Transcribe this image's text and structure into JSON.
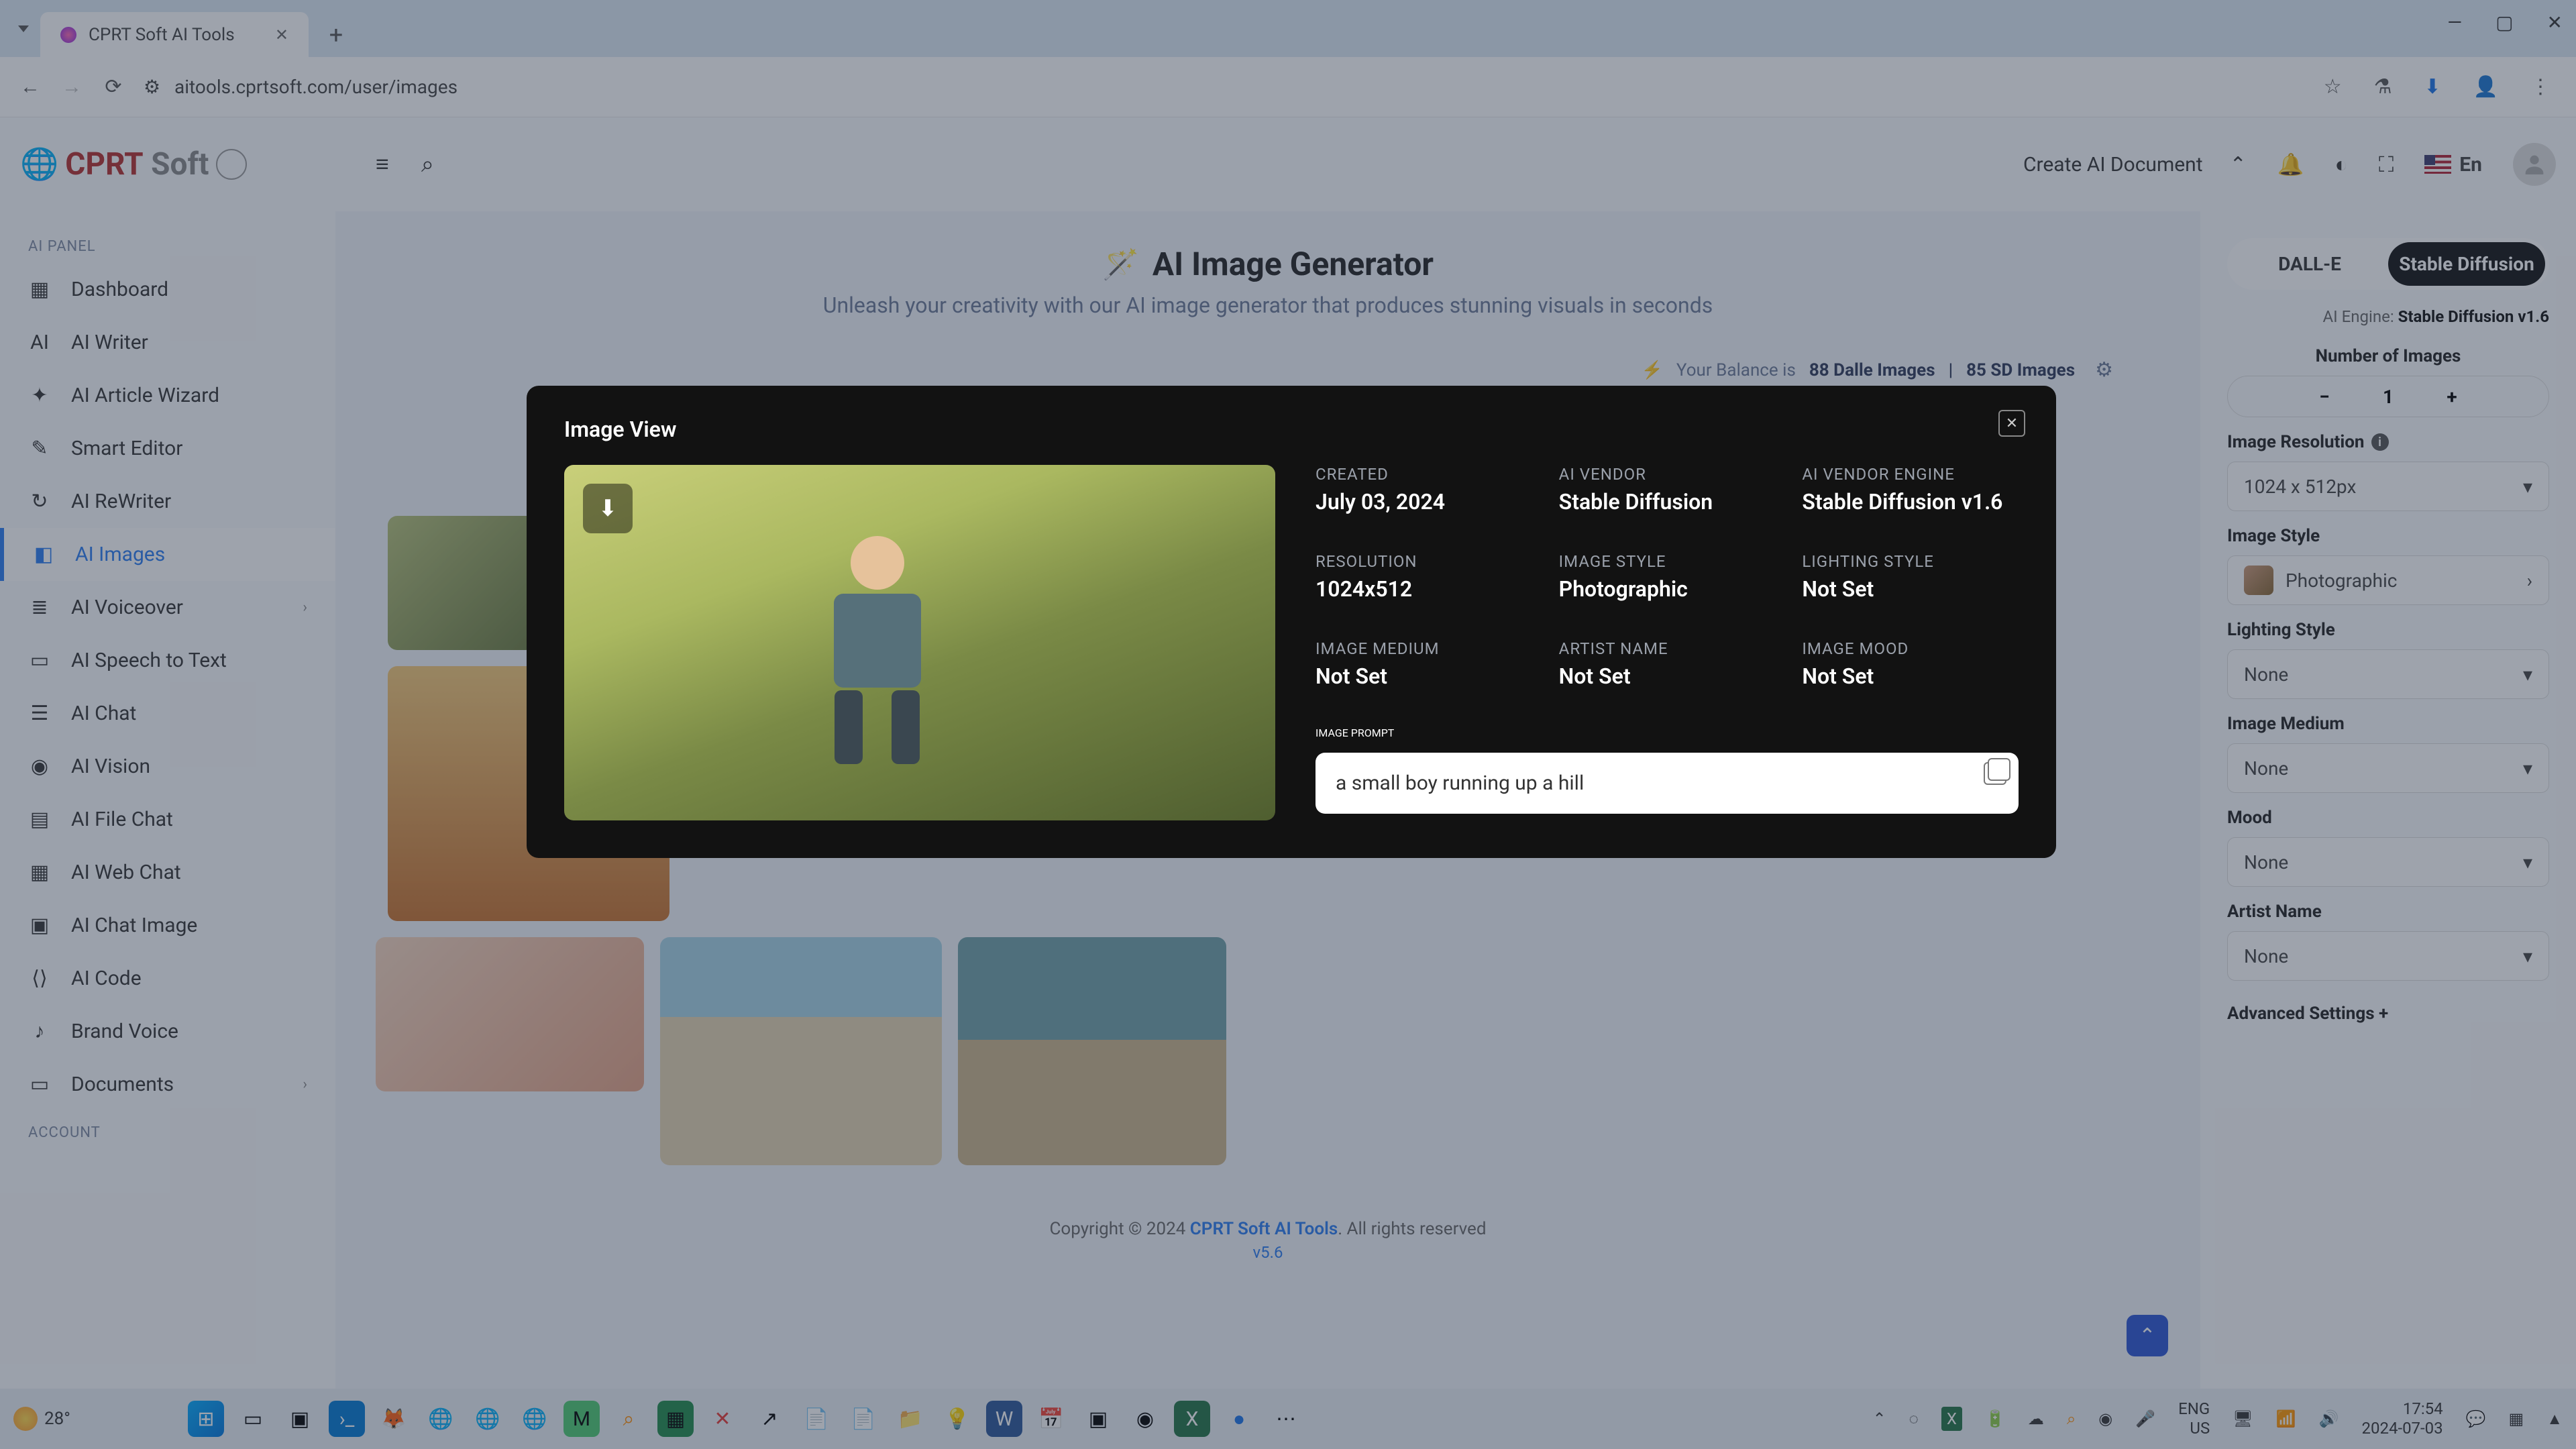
{
  "browser": {
    "tab_title": "CPRT Soft AI Tools",
    "url": "aitools.cprtsoft.com/user/images"
  },
  "window_controls": {
    "min": "—",
    "max": "▢",
    "close": "✕"
  },
  "header": {
    "logo_main": "CPRT",
    "logo_sub": "Soft",
    "create_doc": "Create AI Document",
    "lang": "En"
  },
  "sidebar": {
    "section1": "AI PANEL",
    "items": [
      {
        "label": "Dashboard",
        "icon": "▦"
      },
      {
        "label": "AI Writer",
        "icon": "AI"
      },
      {
        "label": "AI Article Wizard",
        "icon": "✦"
      },
      {
        "label": "Smart Editor",
        "icon": "✎"
      },
      {
        "label": "AI ReWriter",
        "icon": "↻"
      },
      {
        "label": "AI Images",
        "icon": "◧",
        "active": true
      },
      {
        "label": "AI Voiceover",
        "icon": "≣",
        "chev": true
      },
      {
        "label": "AI Speech to Text",
        "icon": "▭"
      },
      {
        "label": "AI Chat",
        "icon": "☰"
      },
      {
        "label": "AI Vision",
        "icon": "◉"
      },
      {
        "label": "AI File Chat",
        "icon": "▤"
      },
      {
        "label": "AI Web Chat",
        "icon": "▦"
      },
      {
        "label": "AI Chat Image",
        "icon": "▣"
      },
      {
        "label": "AI Code",
        "icon": "⟨⟩"
      },
      {
        "label": "Brand Voice",
        "icon": "♪"
      },
      {
        "label": "Documents",
        "icon": "▭",
        "chev": true
      }
    ],
    "section2": "ACCOUNT"
  },
  "main": {
    "title": "AI Image Generator",
    "subtitle": "Unleash your creativity with our AI image generator that produces stunning visuals in seconds",
    "balance_prefix": "Your Balance is ",
    "balance_dalle": "88 Dalle Images",
    "balance_sep": " | ",
    "balance_sd": "85 SD Images",
    "footer_pre": "Copyright © 2024 ",
    "footer_link": "CPRT Soft AI Tools",
    "footer_post": ". All rights reserved",
    "version": "v5.6"
  },
  "right": {
    "tab_dalle": "DALL-E",
    "tab_sd": "Stable Diffusion",
    "engine_label": "AI Engine: ",
    "engine_value": "Stable Diffusion v1.6",
    "num_label": "Number of Images",
    "num_value": "1",
    "res_label": "Image Resolution",
    "res_value": "1024 x 512px",
    "style_label": "Image Style",
    "style_value": "Photographic",
    "light_label": "Lighting Style",
    "light_value": "None",
    "medium_label": "Image Medium",
    "medium_value": "None",
    "mood_label": "Mood",
    "mood_value": "None",
    "artist_label": "Artist Name",
    "artist_value": "None",
    "advanced": "Advanced Settings +"
  },
  "modal": {
    "title": "Image View",
    "meta": {
      "created_l": "CREATED",
      "created_v": "July 03, 2024",
      "vendor_l": "AI VENDOR",
      "vendor_v": "Stable Diffusion",
      "engine_l": "AI VENDOR ENGINE",
      "engine_v": "Stable Diffusion v1.6",
      "res_l": "RESOLUTION",
      "res_v": "1024x512",
      "style_l": "IMAGE STYLE",
      "style_v": "Photographic",
      "light_l": "LIGHTING STYLE",
      "light_v": "Not Set",
      "medium_l": "IMAGE MEDIUM",
      "medium_v": "Not Set",
      "artist_l": "ARTIST NAME",
      "artist_v": "Not Set",
      "mood_l": "IMAGE MOOD",
      "mood_v": "Not Set",
      "prompt_l": "IMAGE PROMPT"
    },
    "prompt": "a small boy running up a hill"
  },
  "taskbar": {
    "temp": "28°",
    "lang1": "ENG",
    "lang2": "US",
    "time": "17:54",
    "date": "2024-07-03"
  }
}
